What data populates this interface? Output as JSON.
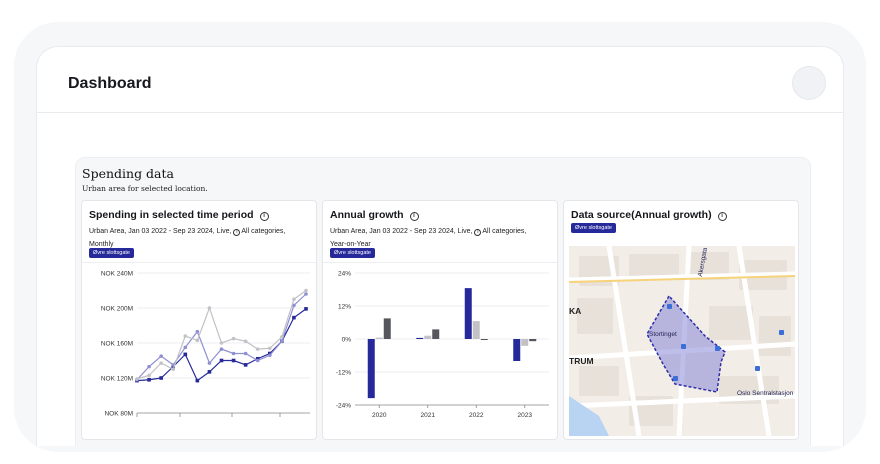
{
  "header": {
    "title": "Dashboard"
  },
  "panel": {
    "title": "Spending data",
    "subtitle": "Urban area for selected location."
  },
  "cards": [
    {
      "title": "Spending in selected time period",
      "meta_line1": "Urban Area, Jan 03 2022 - Sep 23 2024, Live,",
      "meta_tail": "All categories,",
      "meta_line2": "Monthly",
      "badge": "Øvre slottsgate"
    },
    {
      "title": "Annual growth",
      "meta_line1": "Urban Area, Jan 03 2022 - Sep 23 2024, Live,",
      "meta_tail": "All categories,",
      "meta_line2": "Year-on-Year",
      "badge": "Øvre slottsgate"
    },
    {
      "title": "Data source(Annual growth)",
      "badge": "Øvre slottsgate"
    }
  ],
  "map": {
    "labels": [
      "Stortinget",
      "TRUM",
      "KA",
      "Oslo Sentralstasjon",
      "Akersgata"
    ]
  },
  "colors": {
    "navy": "#26299a",
    "lavender": "#8e8fd2",
    "light_gray": "#c2c2c6",
    "dark_gray": "#55575d"
  },
  "chart_data": [
    {
      "type": "line",
      "title": "Spending in selected time period",
      "y_ticks": [
        "NOK 240M",
        "NOK 200M",
        "NOK 160M",
        "NOK 120M",
        "NOK 80M"
      ],
      "ylim": [
        80,
        240
      ],
      "series": [
        {
          "values": [
            117,
            118,
            120,
            133,
            147,
            117,
            127,
            140,
            140,
            135,
            142,
            148,
            162,
            189,
            199
          ]
        },
        {
          "values": [
            118,
            133,
            145,
            135,
            155,
            173,
            137,
            153,
            148,
            148,
            140,
            146,
            162,
            203,
            216
          ]
        },
        {
          "values": [
            119,
            123,
            137,
            130,
            168,
            163,
            200,
            160,
            165,
            162,
            153,
            154,
            167,
            210,
            220
          ]
        }
      ]
    },
    {
      "type": "bar",
      "title": "Annual growth",
      "categories": [
        "2020",
        "2021",
        "2022",
        "2023"
      ],
      "y_ticks": [
        "24%",
        "12%",
        "0%",
        "-12%",
        "-24%"
      ],
      "ylim": [
        -24,
        24
      ],
      "series": [
        {
          "values": [
            -21.5,
            0.4,
            18.5,
            -8.0
          ]
        },
        {
          "values": [
            0.5,
            1.2,
            6.5,
            -2.5
          ]
        },
        {
          "values": [
            7.5,
            3.5,
            -0.3,
            -0.8
          ]
        }
      ]
    }
  ]
}
